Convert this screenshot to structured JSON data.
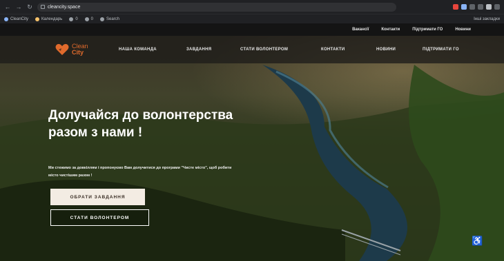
{
  "browser": {
    "url": "cleancity.space",
    "bookmarks": [
      {
        "label": "CleanCity"
      },
      {
        "label": "Календарь"
      },
      {
        "label": "0"
      },
      {
        "label": "0"
      },
      {
        "label": "Search"
      }
    ],
    "bookmarks_right": "Інші закладки"
  },
  "site": {
    "topbar": [
      {
        "label": "Вакансії"
      },
      {
        "label": "Контакти"
      },
      {
        "label": "Підтримати ГО"
      },
      {
        "label": "Новини"
      }
    ],
    "logo": {
      "line1": "Clean",
      "line2": "City"
    },
    "nav": [
      {
        "label": "НАША КОМАНДА"
      },
      {
        "label": "ЗАВДАННЯ"
      },
      {
        "label": "СТАТИ ВОЛОНТЕРОМ"
      },
      {
        "label": "КОНТАКТИ"
      },
      {
        "label": "НОВИНИ"
      },
      {
        "label": "ПІДТРИМАТИ ГО"
      }
    ],
    "hero": {
      "title": "Долучайся до волонтерства разом з нами !",
      "subtitle": "Ми стежимо за довкіллям і пропонуємо Вам долучитися до програми \"Чисте місто\", щоб робити місто чистішим разом !",
      "primary_button": "ОБРАТИ ЗАВДАННЯ",
      "secondary_button": "СТАТИ ВОЛОНТЕРОМ"
    }
  },
  "colors": {
    "brand": "#e06a2c",
    "nav_bg": "#1e1c19"
  }
}
